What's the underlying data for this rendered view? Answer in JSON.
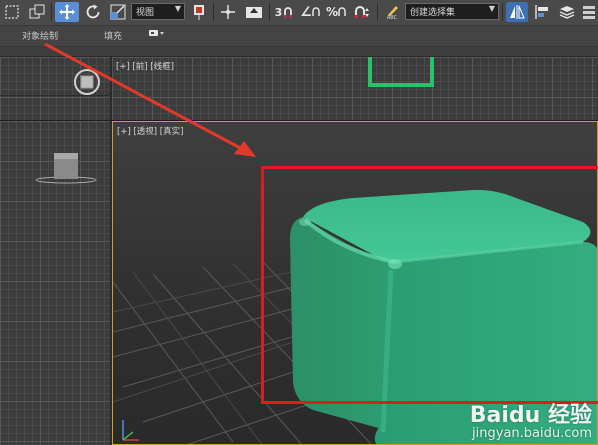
{
  "toolbar": {
    "view_dropdown": "视图",
    "selection_set_dropdown": "创建选择集",
    "snap_label": "3",
    "angle_snap_label": "∠",
    "percent_snap_label": "%",
    "spinner_snap_label": "n",
    "edit_named_sets_label": "ABC"
  },
  "ribbon": {
    "tab_object_paint": "对象绘制",
    "tab_fill": "填充"
  },
  "viewports": {
    "top_label": "[+] [前] [线框]",
    "persp_label": "[+] [透视] [真实]"
  },
  "scene": {
    "box_color": "#2fa37a",
    "highlight_color": "#e01b1b",
    "arrow_color": "#e23a2a"
  },
  "watermark": {
    "brand": "Baidu 经验",
    "site": "jingyan.baidu.com"
  }
}
